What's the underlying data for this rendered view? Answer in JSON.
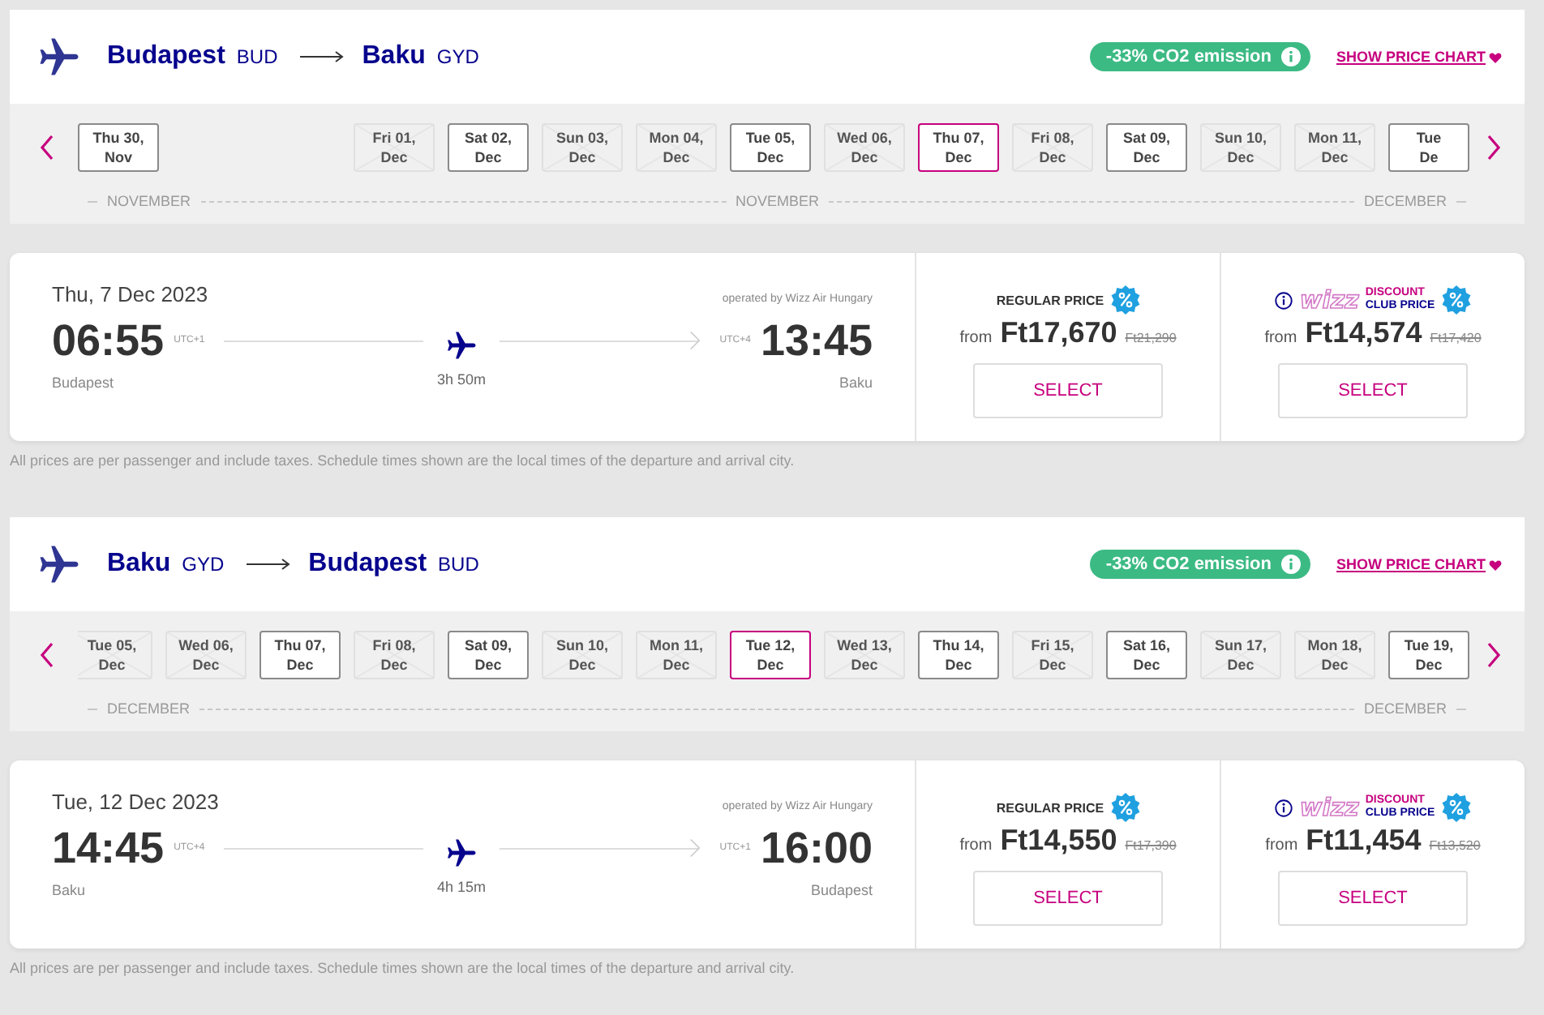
{
  "legs": [
    {
      "from": {
        "city": "Budapest",
        "code": "BUD"
      },
      "to": {
        "city": "Baku",
        "code": "GYD"
      },
      "co2": "-33% CO2 emission",
      "price_chart": "SHOW PRICE CHART",
      "dates": [
        {
          "day": "Thu 30,",
          "month": "Nov",
          "available": true,
          "selected": false
        },
        {
          "day": "Fri 01,",
          "month": "Dec",
          "available": false,
          "selected": false
        },
        {
          "day": "Sat 02,",
          "month": "Dec",
          "available": true,
          "selected": false
        },
        {
          "day": "Sun 03,",
          "month": "Dec",
          "available": false,
          "selected": false
        },
        {
          "day": "Mon 04,",
          "month": "Dec",
          "available": false,
          "selected": false
        },
        {
          "day": "Tue 05,",
          "month": "Dec",
          "available": true,
          "selected": false
        },
        {
          "day": "Wed 06,",
          "month": "Dec",
          "available": false,
          "selected": false
        },
        {
          "day": "Thu 07,",
          "month": "Dec",
          "available": true,
          "selected": true
        },
        {
          "day": "Fri 08,",
          "month": "Dec",
          "available": false,
          "selected": false
        },
        {
          "day": "Sat 09,",
          "month": "Dec",
          "available": true,
          "selected": false
        },
        {
          "day": "Sun 10,",
          "month": "Dec",
          "available": false,
          "selected": false
        },
        {
          "day": "Mon 11,",
          "month": "Dec",
          "available": false,
          "selected": false
        },
        {
          "day": "Tue",
          "month": "De",
          "available": true,
          "selected": false
        }
      ],
      "months": [
        "NOVEMBER",
        "NOVEMBER",
        "DECEMBER"
      ],
      "flight": {
        "date": "Thu, 7 Dec 2023",
        "operator": "operated by Wizz Air Hungary",
        "dep_time": "06:55",
        "dep_tz": "UTC+1",
        "arr_time": "13:45",
        "arr_tz": "UTC+4",
        "duration": "3h 50m",
        "dep_city": "Budapest",
        "arr_city": "Baku"
      },
      "prices": [
        {
          "kind": "regular",
          "label": "REGULAR PRICE",
          "from": "from",
          "price": "Ft17,670",
          "old_price": "Ft21,290",
          "button": "SELECT"
        },
        {
          "kind": "club",
          "logo": "wizz",
          "label_top": "DISCOUNT",
          "label_bottom": "CLUB PRICE",
          "from": "from",
          "price": "Ft14,574",
          "old_price": "Ft17,420",
          "button": "SELECT"
        }
      ],
      "note": "All prices are per passenger and include taxes. Schedule times shown are the local times of the departure and arrival city."
    },
    {
      "from": {
        "city": "Baku",
        "code": "GYD"
      },
      "to": {
        "city": "Budapest",
        "code": "BUD"
      },
      "co2": "-33% CO2 emission",
      "price_chart": "SHOW PRICE CHART",
      "dates": [
        {
          "day": "Tue 05,",
          "month": "Dec",
          "available": false,
          "selected": false
        },
        {
          "day": "Wed 06,",
          "month": "Dec",
          "available": false,
          "selected": false
        },
        {
          "day": "Thu 07,",
          "month": "Dec",
          "available": true,
          "selected": false
        },
        {
          "day": "Fri 08,",
          "month": "Dec",
          "available": false,
          "selected": false
        },
        {
          "day": "Sat 09,",
          "month": "Dec",
          "available": true,
          "selected": false
        },
        {
          "day": "Sun 10,",
          "month": "Dec",
          "available": false,
          "selected": false
        },
        {
          "day": "Mon 11,",
          "month": "Dec",
          "available": false,
          "selected": false
        },
        {
          "day": "Tue 12,",
          "month": "Dec",
          "available": true,
          "selected": true
        },
        {
          "day": "Wed 13,",
          "month": "Dec",
          "available": false,
          "selected": false
        },
        {
          "day": "Thu 14,",
          "month": "Dec",
          "available": true,
          "selected": false
        },
        {
          "day": "Fri 15,",
          "month": "Dec",
          "available": false,
          "selected": false
        },
        {
          "day": "Sat 16,",
          "month": "Dec",
          "available": true,
          "selected": false
        },
        {
          "day": "Sun 17,",
          "month": "Dec",
          "available": false,
          "selected": false
        },
        {
          "day": "Mon 18,",
          "month": "Dec",
          "available": false,
          "selected": false
        },
        {
          "day": "Tue 19,",
          "month": "Dec",
          "available": true,
          "selected": false
        }
      ],
      "months": [
        "DECEMBER",
        "DECEMBER"
      ],
      "flight": {
        "date": "Tue, 12 Dec 2023",
        "operator": "operated by Wizz Air Hungary",
        "dep_time": "14:45",
        "dep_tz": "UTC+4",
        "arr_time": "16:00",
        "arr_tz": "UTC+1",
        "duration": "4h 15m",
        "dep_city": "Baku",
        "arr_city": "Budapest"
      },
      "prices": [
        {
          "kind": "regular",
          "label": "REGULAR PRICE",
          "from": "from",
          "price": "Ft14,550",
          "old_price": "Ft17,390",
          "button": "SELECT"
        },
        {
          "kind": "club",
          "logo": "wizz",
          "label_top": "DISCOUNT",
          "label_bottom": "CLUB PRICE",
          "from": "from",
          "price": "Ft11,454",
          "old_price": "Ft13,520",
          "button": "SELECT"
        }
      ],
      "note": "All prices are per passenger and include taxes. Schedule times shown are the local times of the departure and arrival city."
    }
  ]
}
